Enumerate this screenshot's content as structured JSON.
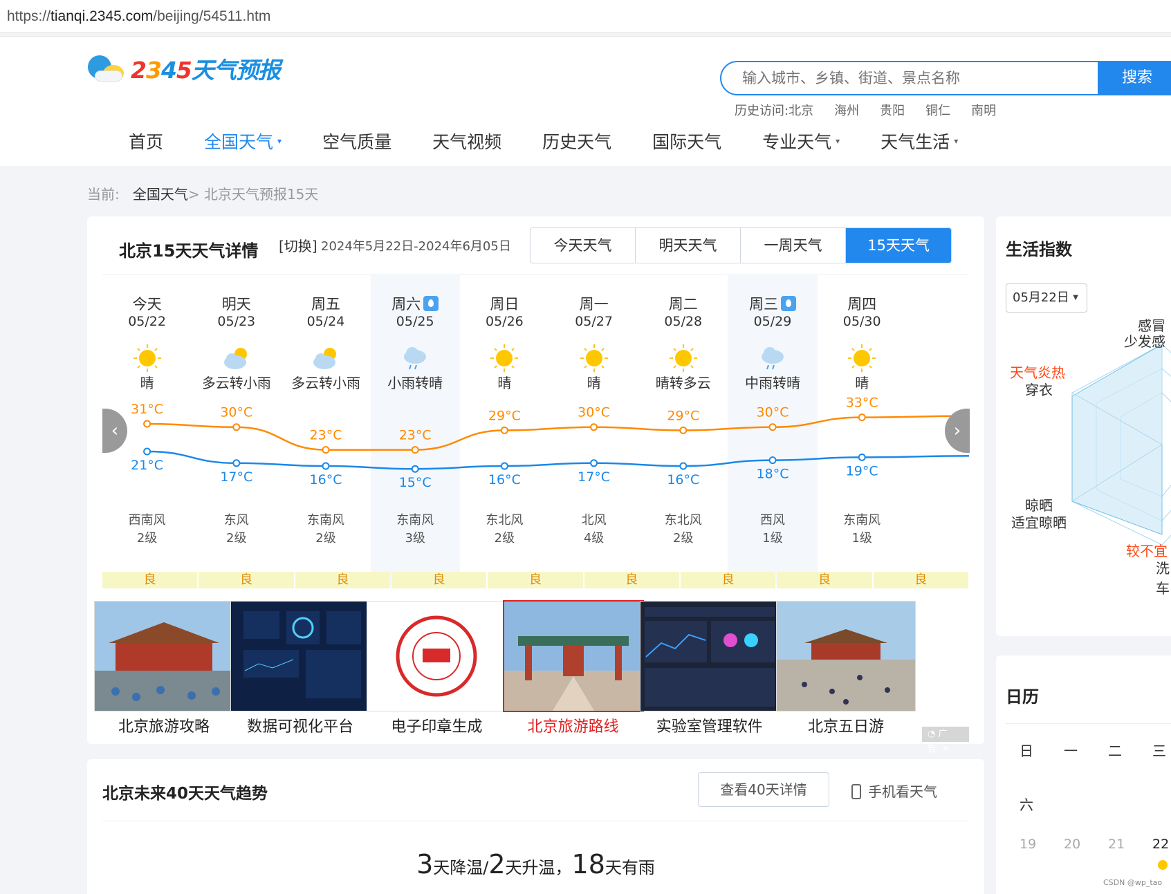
{
  "browser": {
    "url_prefix": "https://",
    "url_host": "tianqi.2345.com",
    "url_path": "/beijing/54511.htm"
  },
  "logo": {
    "digits": [
      "2",
      "3",
      "4",
      "5"
    ],
    "text": "天气预报"
  },
  "search": {
    "placeholder": "输入城市、乡镇、街道、景点名称",
    "button": "搜索"
  },
  "history": {
    "label": "历史访问:",
    "items": [
      "北京",
      "海州",
      "贵阳",
      "铜仁",
      "南明"
    ]
  },
  "nav": [
    {
      "label": "首页"
    },
    {
      "label": "全国天气",
      "dropdown": "▾",
      "active": true
    },
    {
      "label": "空气质量"
    },
    {
      "label": "天气视频"
    },
    {
      "label": "历史天气"
    },
    {
      "label": "国际天气"
    },
    {
      "label": "专业天气",
      "dropdown": "▾"
    },
    {
      "label": "天气生活",
      "dropdown": "▾"
    }
  ],
  "breadcrumb": {
    "prefix": "当前:",
    "mid": "全国天气",
    "sep": ">",
    "current": "北京天气预报15天"
  },
  "forecast": {
    "title": "北京15天天气详情",
    "switch": "[切换]",
    "range": "2024年5月22日-2024年6月05日",
    "tabs": [
      "今天天气",
      "明天天气",
      "一周天气",
      "15天天气"
    ],
    "days": [
      {
        "week": "今天",
        "date": "05/22",
        "icon": "sun-icon",
        "cond": "晴",
        "hi": "31°C",
        "lo": "21°C",
        "wind": "西南风",
        "level": "2级",
        "aqi": "良"
      },
      {
        "week": "明天",
        "date": "05/23",
        "icon": "cloudy-sun-icon",
        "cond": "多云转小雨",
        "hi": "30°C",
        "lo": "17°C",
        "wind": "东风",
        "level": "2级",
        "aqi": "良"
      },
      {
        "week": "周五",
        "date": "05/24",
        "icon": "cloudy-sun-icon",
        "cond": "多云转小雨",
        "hi": "23°C",
        "lo": "16°C",
        "wind": "东南风",
        "level": "2级",
        "aqi": "良"
      },
      {
        "week": "周六",
        "date": "05/25",
        "icon": "rain-cloud-icon",
        "cond": "小雨转晴",
        "hi": "23°C",
        "lo": "15°C",
        "wind": "东南风",
        "level": "3级",
        "aqi": "良",
        "rain": true
      },
      {
        "week": "周日",
        "date": "05/26",
        "icon": "sun-icon",
        "cond": "晴",
        "hi": "29°C",
        "lo": "16°C",
        "wind": "东北风",
        "level": "2级",
        "aqi": "良"
      },
      {
        "week": "周一",
        "date": "05/27",
        "icon": "sun-icon",
        "cond": "晴",
        "hi": "30°C",
        "lo": "17°C",
        "wind": "北风",
        "level": "4级",
        "aqi": "良"
      },
      {
        "week": "周二",
        "date": "05/28",
        "icon": "sun-icon",
        "cond": "晴转多云",
        "hi": "29°C",
        "lo": "16°C",
        "wind": "东北风",
        "level": "2级",
        "aqi": "良"
      },
      {
        "week": "周三",
        "date": "05/29",
        "icon": "rain-cloud-icon",
        "cond": "中雨转晴",
        "hi": "30°C",
        "lo": "18°C",
        "wind": "西风",
        "level": "1级",
        "aqi": "良",
        "rain": true
      },
      {
        "week": "周四",
        "date": "05/30",
        "icon": "sun-icon",
        "cond": "晴",
        "hi": "33°C",
        "lo": "19°C",
        "wind": "东南风",
        "level": "1级",
        "aqi": "良"
      }
    ],
    "hi_values": [
      31,
      30,
      23,
      23,
      29,
      30,
      29,
      30,
      33
    ],
    "lo_values": [
      21,
      17,
      16,
      15,
      16,
      17,
      16,
      18,
      19
    ],
    "prev_icon": "‹",
    "next_icon": "›",
    "colors": {
      "hi": "#ff8a00",
      "lo": "#1a88e8",
      "aqi_bg": "#f7f7c6",
      "aqi_text": "#e08a00"
    }
  },
  "ads": {
    "items": [
      "北京旅游攻略",
      "数据可视化平台",
      "电子印章生成",
      "北京旅游路线",
      "实验室管理软件",
      "北京五日游"
    ],
    "highlight_index": 3,
    "tag": "广告",
    "close": "✕"
  },
  "trend": {
    "title": "北京未来40天天气趋势",
    "button": "查看40天详情",
    "mobile": "手机看天气",
    "summary": [
      {
        "n": "3",
        "t": "天降温/"
      },
      {
        "n": "2",
        "t": "天升温，"
      },
      {
        "n": "18",
        "t": "天有雨"
      }
    ]
  },
  "life": {
    "title": "生活指数",
    "date_select": "05月22日",
    "labels": {
      "cold_top": "感冒",
      "cold_sub": "少发感",
      "dress_top": "天气炎热",
      "dress_sub": "穿衣",
      "dry_top": "晾晒",
      "dry_sub": "适宜晾晒",
      "car_top": "较不宜",
      "car_sub": "洗车"
    }
  },
  "calendar": {
    "title": "日历",
    "weekdays_row1": [
      "日",
      "一",
      "二",
      "三"
    ],
    "weekday_row2": "六",
    "days": [
      "19",
      "20",
      "21",
      "22"
    ]
  },
  "watermark": "CSDN @wp_tao"
}
